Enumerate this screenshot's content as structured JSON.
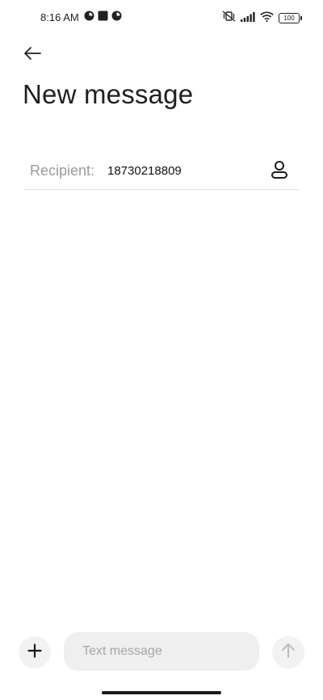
{
  "status_bar": {
    "time": "8:16 AM",
    "battery_level": "100",
    "left_icons": [
      "notification-app-icon",
      "square-notification-icon",
      "notification-app-icon"
    ],
    "right_icons": [
      "vibrate-muted-icon",
      "signal-icon",
      "wifi-icon",
      "battery-icon"
    ]
  },
  "header": {
    "back_icon": "arrow-left-icon",
    "title": "New message"
  },
  "recipient": {
    "label": "Recipient:",
    "value": "18730218809",
    "contacts_icon": "person-icon"
  },
  "composer": {
    "attach_icon": "plus-icon",
    "placeholder": "Text message",
    "send_icon": "arrow-up-icon"
  },
  "colors": {
    "text_primary": "#1f1f1f",
    "label_gray": "#9a9a9a",
    "input_bg": "#efefef",
    "button_bg": "#f2f2f2",
    "disabled_icon": "#bdbdbd"
  }
}
